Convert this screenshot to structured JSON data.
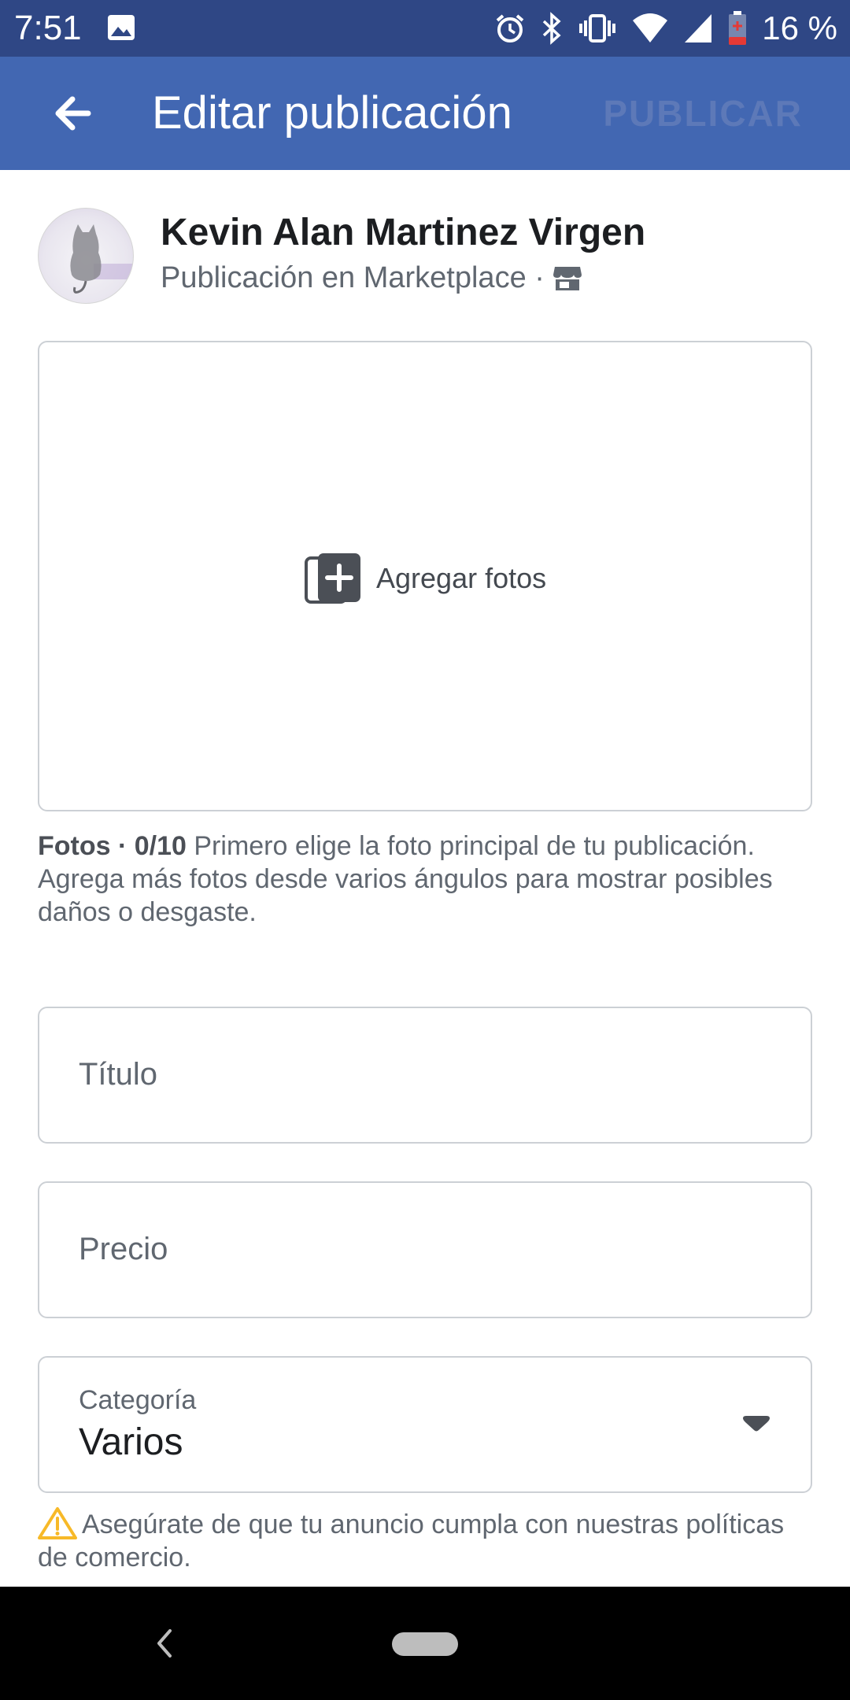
{
  "status_bar": {
    "time": "7:51",
    "battery": "16 %",
    "icons": [
      "image-icon",
      "alarm-icon",
      "bluetooth-icon",
      "vibrate-icon",
      "wifi-icon",
      "signal-icon",
      "battery-icon"
    ]
  },
  "app_bar": {
    "title": "Editar publicación",
    "publish_label": "PUBLICAR",
    "back_icon": "arrow-left-icon"
  },
  "profile": {
    "name": "Kevin Alan Martinez Virgen",
    "subtitle": "Publicación en Marketplace ·",
    "subtitle_icon": "store-icon"
  },
  "photos": {
    "add_label": "Agregar fotos",
    "help_bold": "Fotos · 0/10",
    "help_text": " Primero elige la foto principal de tu publicación. Agrega más fotos desde varios ángulos para mostrar posibles daños o desgaste."
  },
  "form": {
    "title_placeholder": "Título",
    "price_placeholder": "Precio",
    "category_label": "Categoría",
    "category_value": "Varios"
  },
  "notice": {
    "text": "Asegúrate de que tu anuncio cumpla con nuestras políticas de comercio."
  },
  "colors": {
    "status_bar": "#2f4785",
    "app_bar": "#4267b2",
    "publish_disabled": "#5d79b8",
    "warning": "#f7b928"
  }
}
